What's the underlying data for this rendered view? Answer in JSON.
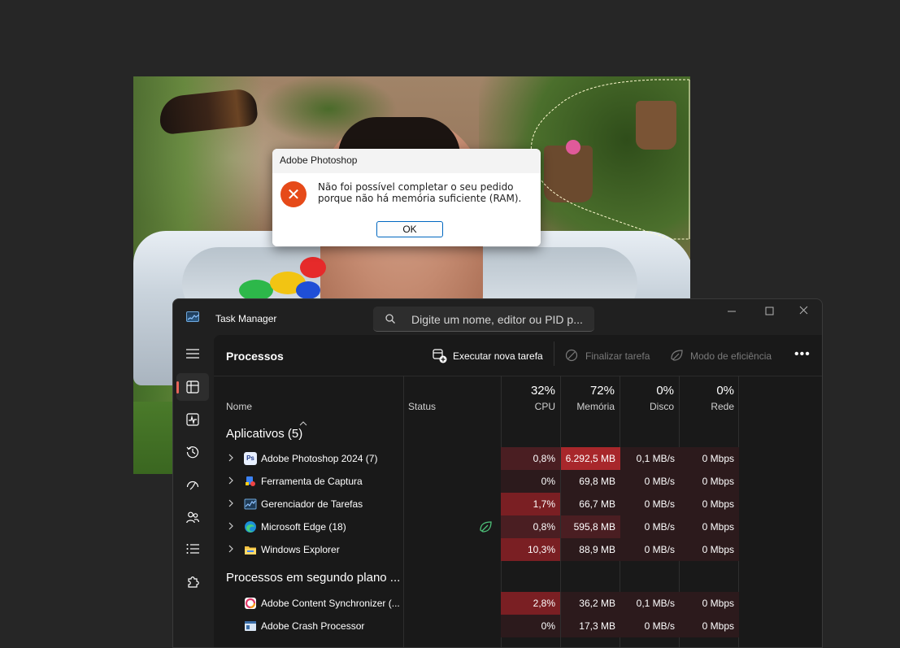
{
  "dialog": {
    "title": "Adobe Photoshop",
    "message": "Não foi possível completar o seu pedido porque não há memória suficiente (RAM).",
    "ok_label": "OK",
    "icon": "error-icon"
  },
  "taskmanager": {
    "title": "Task Manager",
    "search_placeholder": "Digite um nome, editor ou PID p...",
    "heading": "Processos",
    "toolbar": {
      "new_task": "Executar nova tarefa",
      "end_task": "Finalizar tarefa",
      "efficiency": "Modo de eficiência",
      "more": "•••"
    },
    "columns": {
      "name": "Nome",
      "status": "Status",
      "cpu_pct": "32%",
      "cpu": "CPU",
      "mem_pct": "72%",
      "mem": "Memória",
      "disk_pct": "0%",
      "disk": "Disco",
      "net_pct": "0%",
      "net": "Rede"
    },
    "groups": {
      "apps": "Aplicativos (5)",
      "background": "Processos em segundo plano ..."
    },
    "apps": [
      {
        "name": "Adobe Photoshop 2024 (7)",
        "cpu": "0,8%",
        "mem": "6.292,5 MB",
        "disk": "0,1 MB/s",
        "net": "0 Mbps"
      },
      {
        "name": "Ferramenta de Captura",
        "cpu": "0%",
        "mem": "69,8 MB",
        "disk": "0 MB/s",
        "net": "0 Mbps"
      },
      {
        "name": "Gerenciador de Tarefas",
        "cpu": "1,7%",
        "mem": "66,7 MB",
        "disk": "0 MB/s",
        "net": "0 Mbps"
      },
      {
        "name": "Microsoft Edge (18)",
        "cpu": "0,8%",
        "mem": "595,8 MB",
        "disk": "0 MB/s",
        "net": "0 Mbps"
      },
      {
        "name": "Windows Explorer",
        "cpu": "10,3%",
        "mem": "88,9 MB",
        "disk": "0 MB/s",
        "net": "0 Mbps"
      }
    ],
    "background": [
      {
        "name": "Adobe Content Synchronizer (...",
        "cpu": "2,8%",
        "mem": "36,2 MB",
        "disk": "0,1 MB/s",
        "net": "0 Mbps"
      },
      {
        "name": "Adobe Crash Processor",
        "cpu": "0%",
        "mem": "17,3 MB",
        "disk": "0 MB/s",
        "net": "0 Mbps"
      }
    ],
    "colors": {
      "heat_low": "#2c1a1c",
      "heat_mid": "#4a1e22",
      "heat_high": "#7a1f23",
      "heat_max": "#a8272b",
      "accent": "#e8655a"
    }
  }
}
